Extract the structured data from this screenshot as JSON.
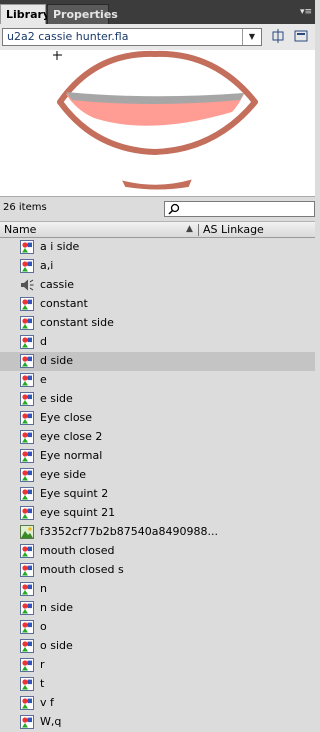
{
  "tabs": {
    "library": "Library",
    "properties": "Properties"
  },
  "document": {
    "name": "u2a2 cassie hunter.fla"
  },
  "item_count": "26 items",
  "columns": {
    "name": "Name",
    "linkage": "AS Linkage"
  },
  "selected_index": 6,
  "items": [
    {
      "label": "a i side",
      "icon": "graphic-symbol-icon"
    },
    {
      "label": "a,i",
      "icon": "graphic-symbol-icon"
    },
    {
      "label": "cassie",
      "icon": "sound-icon"
    },
    {
      "label": "constant",
      "icon": "graphic-symbol-icon"
    },
    {
      "label": "constant side",
      "icon": "graphic-symbol-icon"
    },
    {
      "label": "d",
      "icon": "graphic-symbol-icon"
    },
    {
      "label": "d side",
      "icon": "graphic-symbol-icon"
    },
    {
      "label": "e",
      "icon": "graphic-symbol-icon"
    },
    {
      "label": "e side",
      "icon": "graphic-symbol-icon"
    },
    {
      "label": "Eye close",
      "icon": "graphic-symbol-icon"
    },
    {
      "label": "eye close 2",
      "icon": "graphic-symbol-icon"
    },
    {
      "label": "Eye normal",
      "icon": "graphic-symbol-icon"
    },
    {
      "label": "eye side",
      "icon": "graphic-symbol-icon"
    },
    {
      "label": "Eye squint 2",
      "icon": "graphic-symbol-icon"
    },
    {
      "label": "eye squint 21",
      "icon": "graphic-symbol-icon"
    },
    {
      "label": "f3352cf77b2b87540a8490988...",
      "icon": "bitmap-icon"
    },
    {
      "label": "mouth closed",
      "icon": "graphic-symbol-icon"
    },
    {
      "label": "mouth closed s",
      "icon": "graphic-symbol-icon"
    },
    {
      "label": "n",
      "icon": "graphic-symbol-icon"
    },
    {
      "label": "n side",
      "icon": "graphic-symbol-icon"
    },
    {
      "label": "o",
      "icon": "graphic-symbol-icon"
    },
    {
      "label": "o side",
      "icon": "graphic-symbol-icon"
    },
    {
      "label": "r",
      "icon": "graphic-symbol-icon"
    },
    {
      "label": "t",
      "icon": "graphic-symbol-icon"
    },
    {
      "label": "v f",
      "icon": "graphic-symbol-icon"
    },
    {
      "label": "W,q",
      "icon": "graphic-symbol-icon"
    }
  ]
}
